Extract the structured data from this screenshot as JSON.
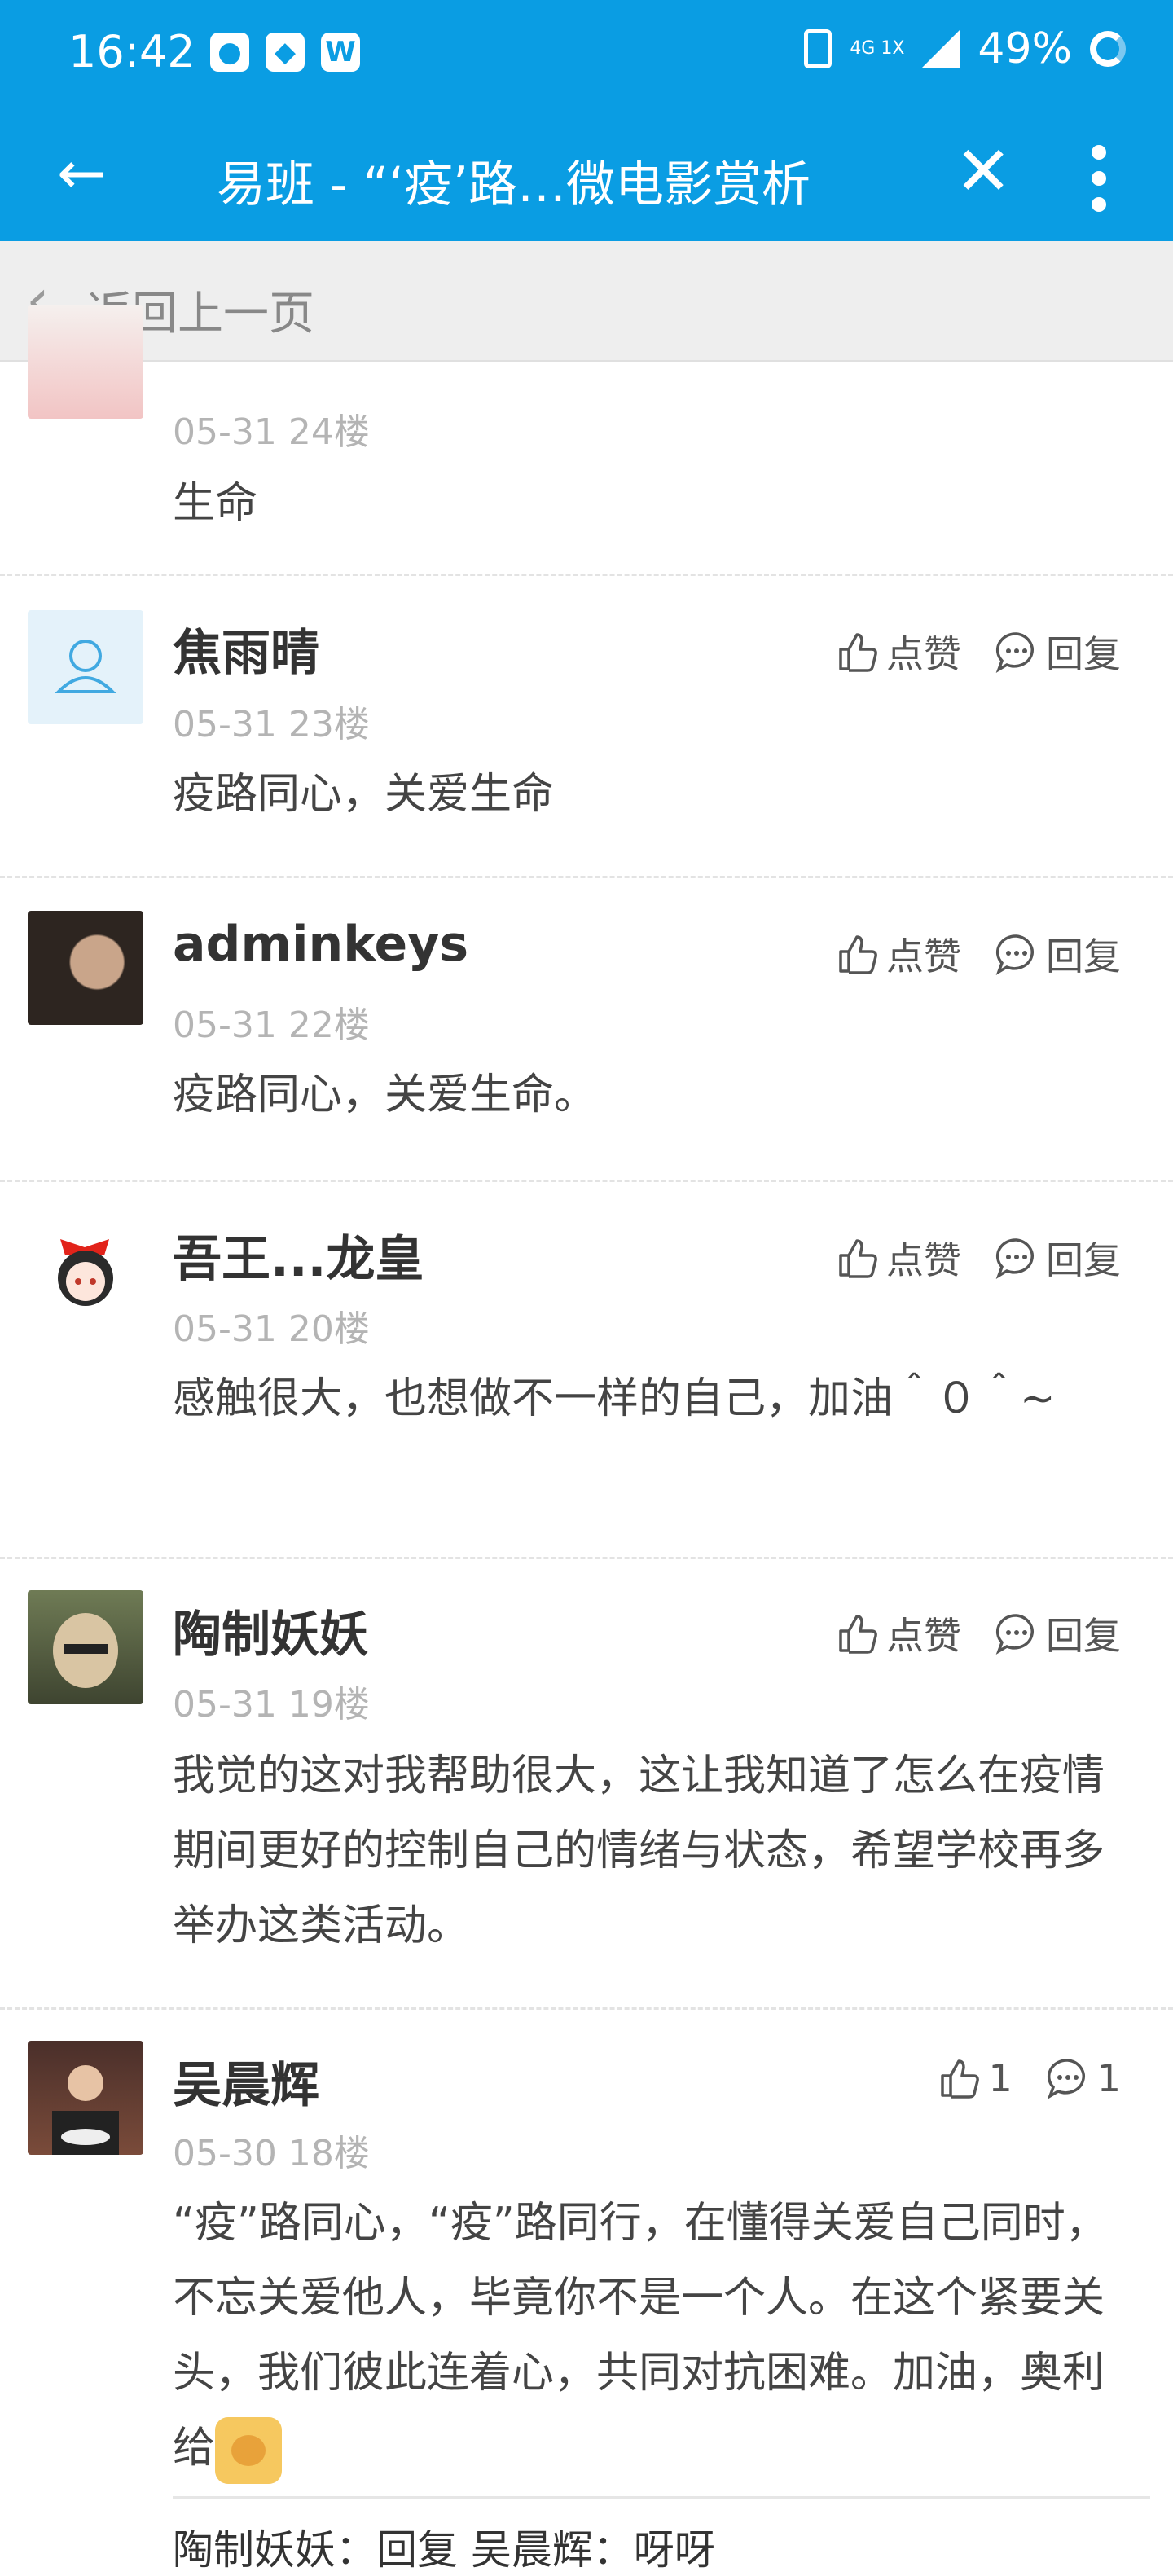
{
  "status": {
    "time": "16:42",
    "battery": "49%",
    "network": "4G 1X"
  },
  "appbar": {
    "title": "易班 - “‘疫’路…微电影赏析"
  },
  "backbar": {
    "label": "返回上一页"
  },
  "action_labels": {
    "like": "点赞",
    "reply": "回复"
  },
  "comments": [
    {
      "name": "",
      "date": "05-31 24楼",
      "text": "生命"
    },
    {
      "name": "焦雨晴",
      "date": "05-31 23楼",
      "text": "疫路同心，关爱生命"
    },
    {
      "name": "adminkeys",
      "date": "05-31 22楼",
      "text": "疫路同心，关爱生命。"
    },
    {
      "name": "吾王...龙皇",
      "date": "05-31 20楼",
      "text": "感触很大，也想做不一样的自己，加油＾０＾~"
    },
    {
      "name": "陶制妖妖",
      "date": "05-31 19楼",
      "text": "我觉的这对我帮助很大，这让我知道了怎么在疫情期间更好的控制自己的情绪与状态，希望学校再多举办这类活动。"
    },
    {
      "name": "吴晨辉",
      "date": "05-30 18楼",
      "text": "“疫”路同心，“疫”路同行，在懂得关爱自己同时，不忘关爱他人，毕竟你不是一个人。在这个紧要关头，我们彼此连着心，共同对抗困难。加油，奥利给",
      "likes": "1",
      "replies": "1"
    }
  ],
  "reply_preview": "陶制妖妖：回复 吴晨辉：呀呀"
}
